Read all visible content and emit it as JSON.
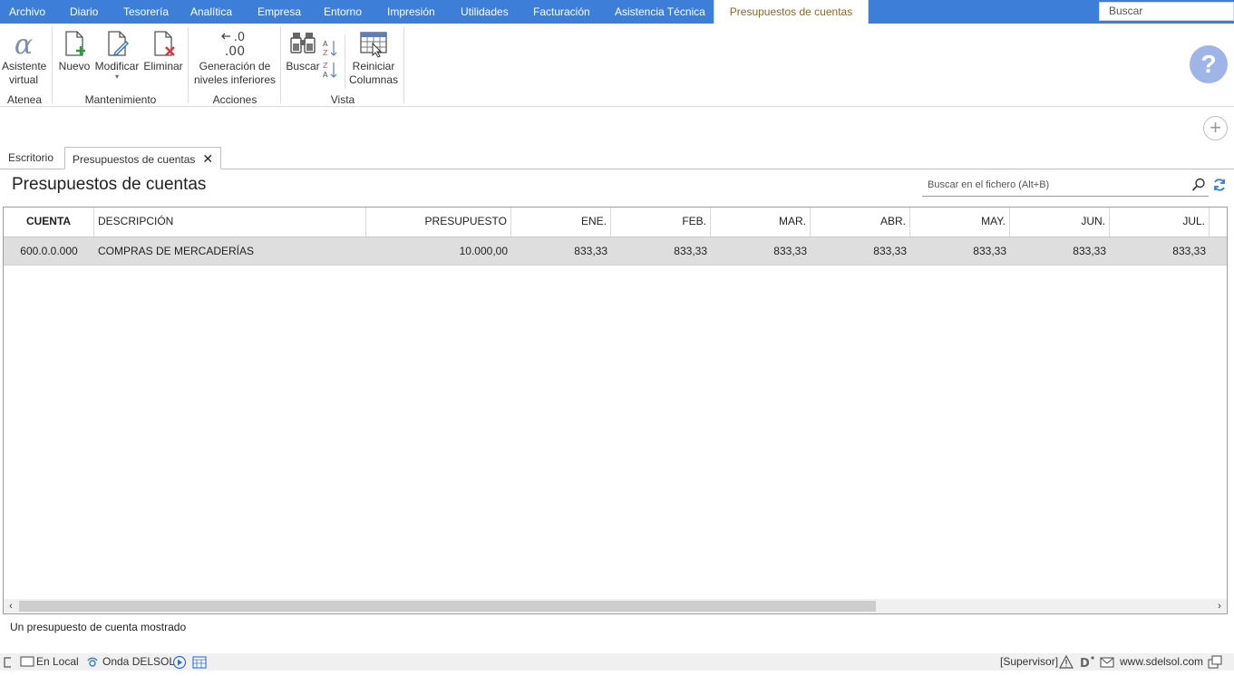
{
  "menu": {
    "items": [
      "Archivo",
      "Diario",
      "Tesorería",
      "Analítica",
      "Empresa",
      "Entorno",
      "Impresión",
      "Utilidades",
      "Facturación",
      "Asistencia Técnica",
      "Presupuestos de cuentas"
    ],
    "active_index": 10,
    "search_placeholder": "Buscar"
  },
  "ribbon": {
    "buttons": {
      "asistente": [
        "Asistente",
        "virtual"
      ],
      "nuevo": "Nuevo",
      "modificar": "Modificar",
      "eliminar": "Eliminar",
      "generacion": [
        "Generación de",
        "niveles inferiores"
      ],
      "buscar": "Buscar",
      "reiniciar": [
        "Reiniciar",
        "Columnas"
      ]
    },
    "groups": {
      "atenea": "Atenea",
      "mantenimiento": "Mantenimiento",
      "acciones": "Acciones",
      "vista": "Vista"
    },
    "help_glyph": "?"
  },
  "doc_tabs": {
    "escritorio": "Escritorio",
    "active": "Presupuestos de cuentas"
  },
  "page": {
    "title": "Presupuestos de cuentas",
    "file_search_placeholder": "Buscar en el fichero (Alt+B)"
  },
  "table": {
    "columns": [
      "CUENTA",
      "DESCRIPCIÓN",
      "PRESUPUESTO",
      "ENE.",
      "FEB.",
      "MAR.",
      "ABR.",
      "MAY.",
      "JUN.",
      "JUL."
    ],
    "rows": [
      [
        "600.0.0.000",
        "COMPRAS DE MERCADERÍAS",
        "10.000,00",
        "833,33",
        "833,33",
        "833,33",
        "833,33",
        "833,33",
        "833,33",
        "833,33"
      ]
    ]
  },
  "status_text": "Un presupuesto de cuenta mostrado",
  "statusbar": {
    "local": "En Local",
    "onda": "Onda DELSOL",
    "supervisor": "[Supervisor]",
    "website": "www.sdelsol.com"
  },
  "colors": {
    "menubar": "#3d7ed8",
    "active_tab_text": "#8a6a1a",
    "row_selected": "#dedede",
    "help": "#9fb5e8"
  }
}
